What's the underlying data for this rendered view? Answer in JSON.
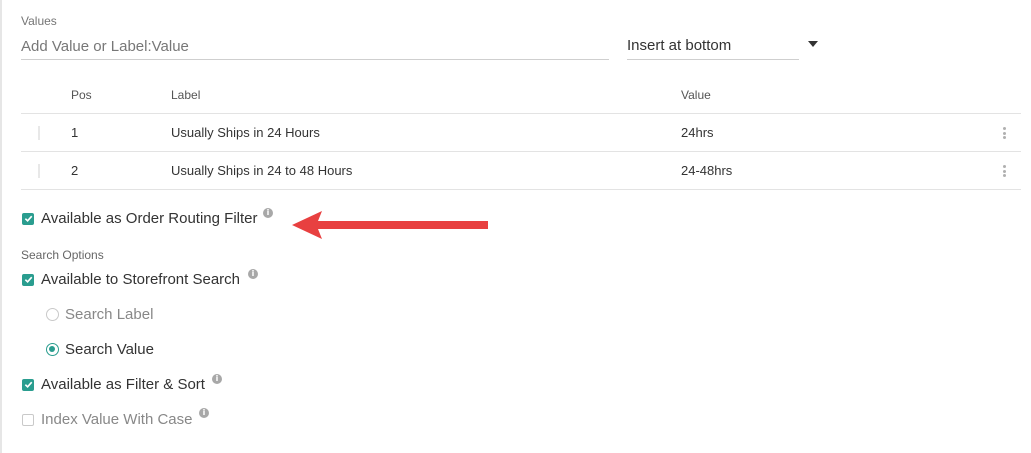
{
  "values_section": {
    "label": "Values",
    "input_placeholder": "Add Value or Label:Value",
    "insert_select_value": "Insert at bottom"
  },
  "table": {
    "columns": {
      "pos": "Pos",
      "label": "Label",
      "value": "Value"
    },
    "rows": [
      {
        "pos": "1",
        "label": "Usually Ships in 24 Hours",
        "value": "24hrs"
      },
      {
        "pos": "2",
        "label": "Usually Ships in 24 to 48 Hours",
        "value": "24-48hrs"
      }
    ]
  },
  "order_routing": {
    "label": "Available as Order Routing Filter",
    "checked": true
  },
  "search_options": {
    "label": "Search Options",
    "storefront_search": {
      "label": "Available to Storefront Search",
      "checked": true
    },
    "radios": [
      {
        "label": "Search Label",
        "selected": false
      },
      {
        "label": "Search Value",
        "selected": true
      }
    ],
    "filter_sort": {
      "label": "Available as Filter & Sort",
      "checked": true
    },
    "index_case": {
      "label": "Index Value With Case",
      "checked": false
    }
  },
  "info_icon_glyph": "i",
  "colors": {
    "accent": "#2a9d8f",
    "annotation_arrow": "#e84040"
  },
  "icons": [
    "info-icon",
    "chevron-down-icon",
    "kebab-menu-icon",
    "drag-handle-icon",
    "check-icon",
    "arrow-annotation"
  ]
}
